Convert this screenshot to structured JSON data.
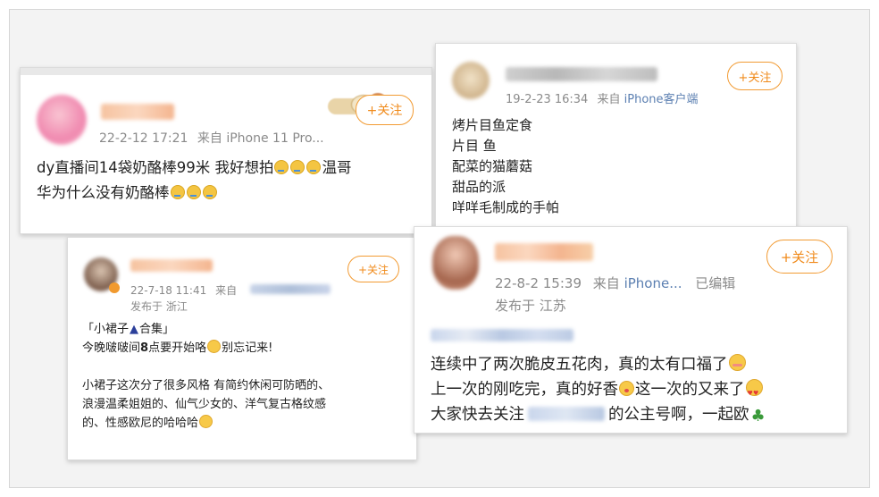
{
  "cards": {
    "top_left": {
      "meta": "22-2-12 17:21",
      "source_prefix": "来自",
      "source": "iPhone 11 Pro...",
      "follow_label": "+关注",
      "lines": {
        "l1_a": "dy直播间14袋奶酪棒99米 我好想拍",
        "l1_b": "温哥",
        "l2_a": "华为什么没有奶酪棒"
      }
    },
    "top_right": {
      "meta": "19-2-23 16:34",
      "source_prefix": "来自",
      "source": "iPhone客户端",
      "follow_label": "+关注",
      "lines": [
        "烤片目鱼定食",
        "片目 鱼",
        "配菜的猫蘑菇",
        "甜品的派",
        "咩咩毛制成的手帕"
      ]
    },
    "bottom_left": {
      "meta": "22-7-18 11:41",
      "source_prefix": "来自",
      "location": "发布于 浙江",
      "follow_label": "+关注",
      "lines": {
        "title_a": "「小裙子",
        "title_b": "合集」",
        "l2_a": "今晚啵啵间",
        "l2_bold": "8",
        "l2_b": "点要开始咯",
        "l2_c": "别忘记来!",
        "l3": "小裙子这次分了很多风格 有简约休闲可防晒的、",
        "l4": "浪漫温柔姐姐的、仙气少女的、洋气复古格纹感",
        "l5": "的、性感欧尼的哈哈哈"
      }
    },
    "bottom_right": {
      "meta": "22-8-2 15:39",
      "source_prefix": "来自",
      "source": "iPhone...",
      "edited": "已编辑",
      "location": "发布于 江苏",
      "follow_label": "+关注",
      "lines": {
        "l1": "连续中了两次脆皮五花肉，真的太有口福了",
        "l2_a": "上一次的刚吃完，真的好香",
        "l2_b": "这一次的又来了",
        "l3_a": "大家快去关注",
        "l3_b": "的公主号啊，一起欧"
      }
    }
  },
  "icons": {
    "cry": "crying-emoji-icon",
    "yum": "yum-emoji-icon",
    "love": "heart-eyes-emoji-icon",
    "blush": "blush-emoji-icon",
    "clover": "clover-icon",
    "dress": "dress-icon"
  },
  "colors": {
    "follow": "#f08a1a",
    "source_link": "#5b7fb1",
    "meta": "#8a8a8a"
  }
}
